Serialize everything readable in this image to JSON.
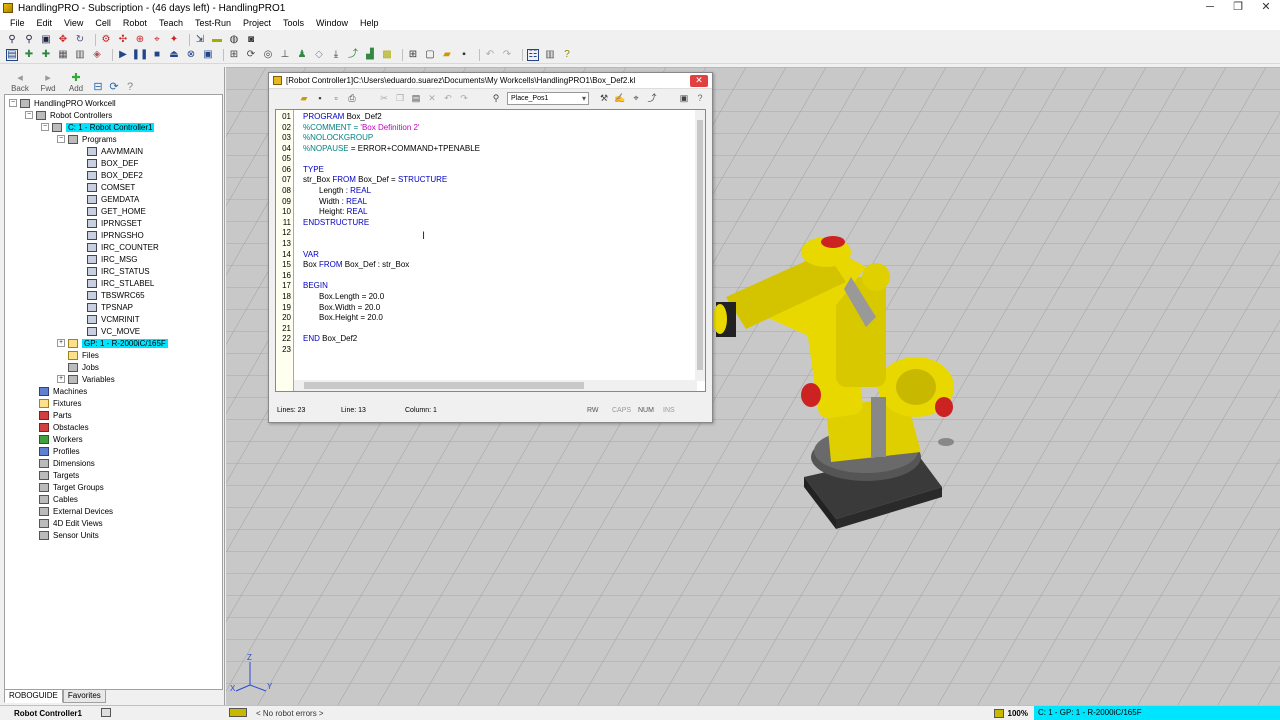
{
  "window": {
    "title": "HandlingPRO - Subscription - (46 days left) - HandlingPRO1",
    "minimize": "─",
    "restore": "❐",
    "close": "✕"
  },
  "menu": [
    "File",
    "Edit",
    "View",
    "Cell",
    "Robot",
    "Teach",
    "Test-Run",
    "Project",
    "Tools",
    "Window",
    "Help"
  ],
  "nav": {
    "back": "Back",
    "fwd": "Fwd",
    "add": "Add"
  },
  "tree": {
    "root": "HandlingPRO Workcell",
    "robot_controllers": "Robot Controllers",
    "controller": "C: 1 - Robot Controller1",
    "programs": "Programs",
    "program_list": [
      "AAVMMAIN",
      "BOX_DEF",
      "BOX_DEF2",
      "COMSET",
      "GEMDATA",
      "GET_HOME",
      "IPRNGSET",
      "IPRNGSHO",
      "IRC_COUNTER",
      "IRC_MSG",
      "IRC_STATUS",
      "IRC_STLABEL",
      "TBSWRC65",
      "TPSNAP",
      "VCMRINIT",
      "VC_MOVE"
    ],
    "gp": "GP: 1 - R-2000iC/165F",
    "files": "Files",
    "jobs": "Jobs",
    "variables": "Variables",
    "machines": "Machines",
    "fixtures": "Fixtures",
    "parts": "Parts",
    "obstacles": "Obstacles",
    "workers": "Workers",
    "profiles": "Profiles",
    "dimensions": "Dimensions",
    "targets": "Targets",
    "target_groups": "Target Groups",
    "cables": "Cables",
    "external_devices": "External Devices",
    "edit_views": "4D Edit Views",
    "sensor_units": "Sensor Units"
  },
  "tabs": {
    "roboguide": "ROBOGUIDE",
    "favorites": "Favorites"
  },
  "editor": {
    "title": "[Robot Controller1]C:\\Users\\eduardo.suarez\\Documents\\My Workcells\\HandlingPRO1\\Box_Def2.kl",
    "position_combo": "Place_Pos1",
    "line_numbers": [
      "01",
      "02",
      "03",
      "04",
      "05",
      "06",
      "07",
      "08",
      "09",
      "10",
      "11",
      "12",
      "13",
      "14",
      "15",
      "16",
      "17",
      "18",
      "19",
      "20",
      "21",
      "22",
      "23"
    ],
    "code": {
      "l01a": "PROGRAM",
      "l01b": " Box_Def2",
      "l02a": "%COMMENT = ",
      "l02b": "'Box Definition 2'",
      "l03": "%NOLOCKGROUP",
      "l04a": "%NOPAUSE",
      "l04b": " = ERROR+COMMAND+TPENABLE",
      "l06": "TYPE",
      "l07a": "str_Box ",
      "l07b": "FROM",
      "l07c": " Box_Def = ",
      "l07d": "STRUCTURE",
      "l08a": "Length : ",
      "l08b": "REAL",
      "l09a": "Width : ",
      "l09b": "REAL",
      "l10a": "Height: ",
      "l10b": "REAL",
      "l11": "ENDSTRUCTURE",
      "l14": "VAR",
      "l15a": "Box ",
      "l15b": "FROM",
      "l15c": " Box_Def : str_Box",
      "l17": "BEGIN",
      "l18": "Box.Length = 20.0",
      "l19": "Box.Width = 20.0",
      "l20": "Box.Height = 20.0",
      "l22a": "END",
      "l22b": " Box_Def2"
    },
    "status": {
      "lines": "Lines: 23",
      "line": "Line: 13",
      "column": "Column: 1",
      "rw": "RW",
      "caps": "CAPS",
      "num": "NUM",
      "ins": "INS"
    }
  },
  "axes": {
    "x": "X",
    "y": "Y",
    "z": "Z"
  },
  "statusbar": {
    "controller": "Robot Controller1",
    "errors": "< No robot errors >",
    "zoom": "100%",
    "gp": "C: 1 - GP: 1 - R-2000iC/165F"
  },
  "colors": {
    "selection": "#00e5ff",
    "robot_yellow": "#e8d800",
    "floor": "#c8c8c8"
  }
}
